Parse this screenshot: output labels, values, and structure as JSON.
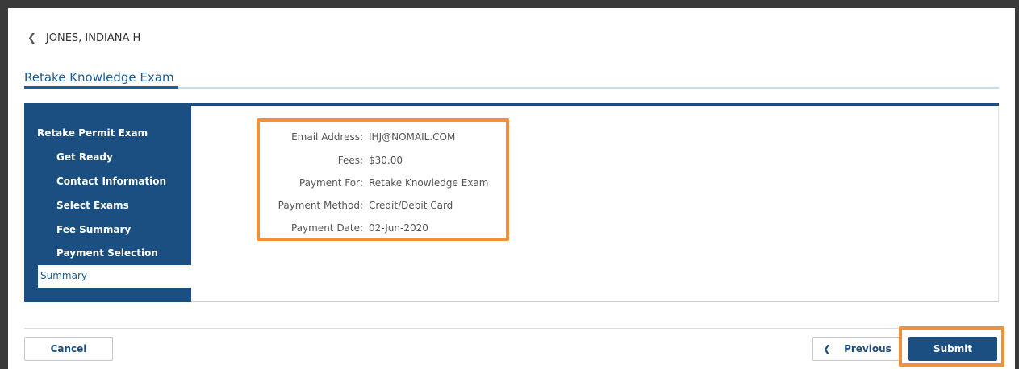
{
  "header": {
    "back_icon": "chevron-left-icon",
    "back_label": "JONES, INDIANA H"
  },
  "page": {
    "title": "Retake Knowledge Exam"
  },
  "sidebar": {
    "heading": "Retake Permit Exam",
    "items": [
      {
        "label": "Get Ready"
      },
      {
        "label": "Contact Information"
      },
      {
        "label": "Select Exams"
      },
      {
        "label": "Fee Summary"
      },
      {
        "label": "Payment Selection"
      },
      {
        "label": "Summary",
        "active": true
      }
    ]
  },
  "summary": {
    "rows": [
      {
        "label": "Email Address",
        "value": "IHJ@NOMAIL.COM"
      },
      {
        "label": "Fees",
        "value": "$30.00"
      },
      {
        "label": "Payment For",
        "value": "Retake Knowledge Exam"
      },
      {
        "label": "Payment Method",
        "value": "Credit/Debit Card"
      },
      {
        "label": "Payment Date",
        "value": "02-Jun-2020"
      }
    ],
    "separator": ":"
  },
  "footer": {
    "cancel_label": "Cancel",
    "previous_label": "Previous",
    "previous_icon": "chevron-left-icon",
    "submit_label": "Submit"
  },
  "colors": {
    "primary": "#1b4f82",
    "link": "#1b5e96",
    "highlight": "#f0923b"
  }
}
